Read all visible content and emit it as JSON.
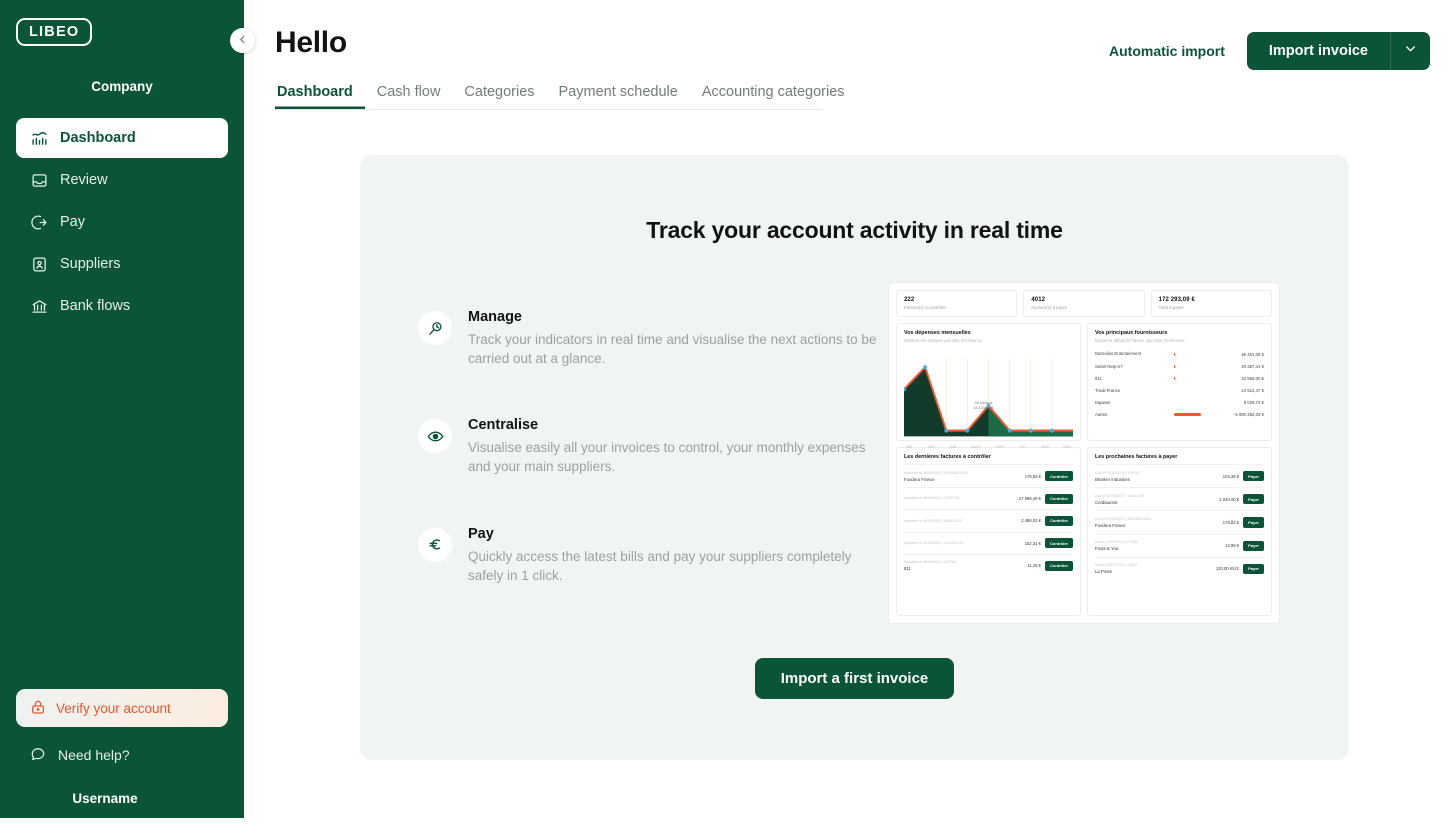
{
  "sidebar": {
    "logo_text": "LIBEO",
    "company_name": "Company",
    "username": "Username",
    "collapse_icon": "chevron-left-icon",
    "items": [
      {
        "label": "Dashboard",
        "icon": "analytics-chart-icon",
        "active": true
      },
      {
        "label": "Review",
        "icon": "inbox-tray-icon",
        "active": false
      },
      {
        "label": "Pay",
        "icon": "arrow-exit-icon",
        "active": false
      },
      {
        "label": "Suppliers",
        "icon": "contact-card-icon",
        "active": false
      },
      {
        "label": "Bank flows",
        "icon": "bank-building-icon",
        "active": false
      }
    ],
    "verify": {
      "label": "Verify your account",
      "icon": "lock-icon"
    },
    "help": {
      "label": "Need help?",
      "icon": "chat-bubble-icon"
    }
  },
  "header": {
    "title": "Hello",
    "automatic_import": "Automatic import",
    "import_invoice": "Import invoice",
    "import_caret_icon": "chevron-down-icon"
  },
  "tabs": [
    {
      "label": "Dashboard",
      "active": true
    },
    {
      "label": "Cash flow",
      "active": false
    },
    {
      "label": "Categories",
      "active": false
    },
    {
      "label": "Payment schedule",
      "active": false
    },
    {
      "label": "Accounting categories",
      "active": false
    }
  ],
  "hero": {
    "title": "Track your account activity in real time",
    "cta": "Import a first invoice",
    "features": [
      {
        "icon": "magnifier-gauge-icon",
        "title": "Manage",
        "desc": "Track your indicators in real time and visualise the next actions to be carried out at a glance."
      },
      {
        "icon": "eye-icon",
        "title": "Centralise",
        "desc": "Visualise easily all your invoices to control, your monthly expenses and your main suppliers."
      },
      {
        "icon": "euro-icon",
        "title": "Pay",
        "desc": "Quickly access the latest bills and pay your suppliers completely safely in 1 click."
      }
    ]
  },
  "preview": {
    "stats": [
      {
        "value": "222",
        "label": "Facture(s) à contrôler"
      },
      {
        "value": "4012",
        "label": "Facture(s) à payer"
      },
      {
        "value": "172 293,09 €",
        "label": "Total à payer"
      }
    ],
    "expenses": {
      "title": "Vos dépenses mensuelles",
      "subtitle": "Montant des factures par date d'échéance",
      "note_line1": "Ce mois-ci",
      "note_line2": "15 133,80 €",
      "ticks": [
        "MAI",
        "JUIN",
        "JUIL",
        "AOÛT",
        "SEPT",
        "OCT",
        "NOV",
        "DÉC"
      ]
    },
    "suppliers": {
      "title": "Vos principaux fournisseurs",
      "subtitle": "Depuis le début de l'année, par date d'échéance",
      "rows": [
        {
          "name": "Darnelius Entertainment",
          "amount": "46 451,08 €",
          "bar": 3
        },
        {
          "name": "Selart Netp-n7",
          "amount": "40 387,41 €",
          "bar": 3
        },
        {
          "name": "811",
          "amount": "22 560,00 €",
          "bar": 2
        },
        {
          "name": "Trusk France",
          "amount": "14 512,47 €",
          "bar": 0
        },
        {
          "name": "Kapwee",
          "amount": "9 026,72 €",
          "bar": 0
        },
        {
          "name": "Autres",
          "amount": "-5 080 282,03 €",
          "bar": 100
        }
      ]
    },
    "to_control": {
      "title": "Les dernières factures à contrôler",
      "button": "Contrôler",
      "rows": [
        {
          "ref": "Importée le 06/08/2021 | 987846521441",
          "name": "Foodera France",
          "amount": "175,83 €"
        },
        {
          "ref": "Importée le 06/08/2021 | 22857781",
          "name": "",
          "amount": "27 966,40 €"
        },
        {
          "ref": "Importée le 06/08/2021 | 448644073",
          "name": "",
          "amount": "2 486,03 €"
        },
        {
          "ref": "Importée le 06/08/2021 | 1014417191",
          "name": "",
          "amount": "152,31 €"
        },
        {
          "ref": "Importée le 06/08/2021 | AC2387",
          "name": "811",
          "amount": "11,28 €"
        }
      ]
    },
    "to_pay": {
      "title": "Les prochaines factures à payer",
      "button": "Payer",
      "rows": [
        {
          "ref": "Due le 10/12/2019 | 174709",
          "name": "Bharker Industries",
          "amount": "104,35 €"
        },
        {
          "ref": "Due le 31/03/2017 | 1/0024199",
          "name": "Cordiaurent",
          "amount": "1 020,00 €"
        },
        {
          "ref": "Due le 07/06/2019 | 987846521441",
          "name": "Foodera France",
          "amount": "175,83 €"
        },
        {
          "ref": "Due le 11/07/2020 | C1383",
          "name": "Fruits & You",
          "amount": "12,99 €"
        },
        {
          "ref": "Due le 10/07/2020 | C1011",
          "name": "La Poste",
          "amount": "120,00 €/US"
        }
      ]
    }
  },
  "chart_data": {
    "type": "area",
    "title": "Vos dépenses mensuelles",
    "xlabel": "",
    "ylabel": "",
    "categories": [
      "MAI",
      "JUIN",
      "JUIL",
      "AOÛT",
      "SEPT",
      "OCT",
      "NOV",
      "DÉC"
    ],
    "values": [
      62,
      88,
      3,
      3,
      33,
      3,
      3,
      3
    ],
    "ylim": [
      0,
      100
    ],
    "grid": true,
    "legend": "none",
    "annotation": "Ce mois-ci 15 133,80 €",
    "colors": {
      "fill": "#113b2b",
      "line": "#f2582c",
      "point": "#3aa8e0"
    }
  },
  "colors": {
    "brand_green": "#0a5537",
    "accent_orange": "#f2582c",
    "card_bg": "#f0f4f2",
    "muted_text": "#9aa3a1"
  }
}
